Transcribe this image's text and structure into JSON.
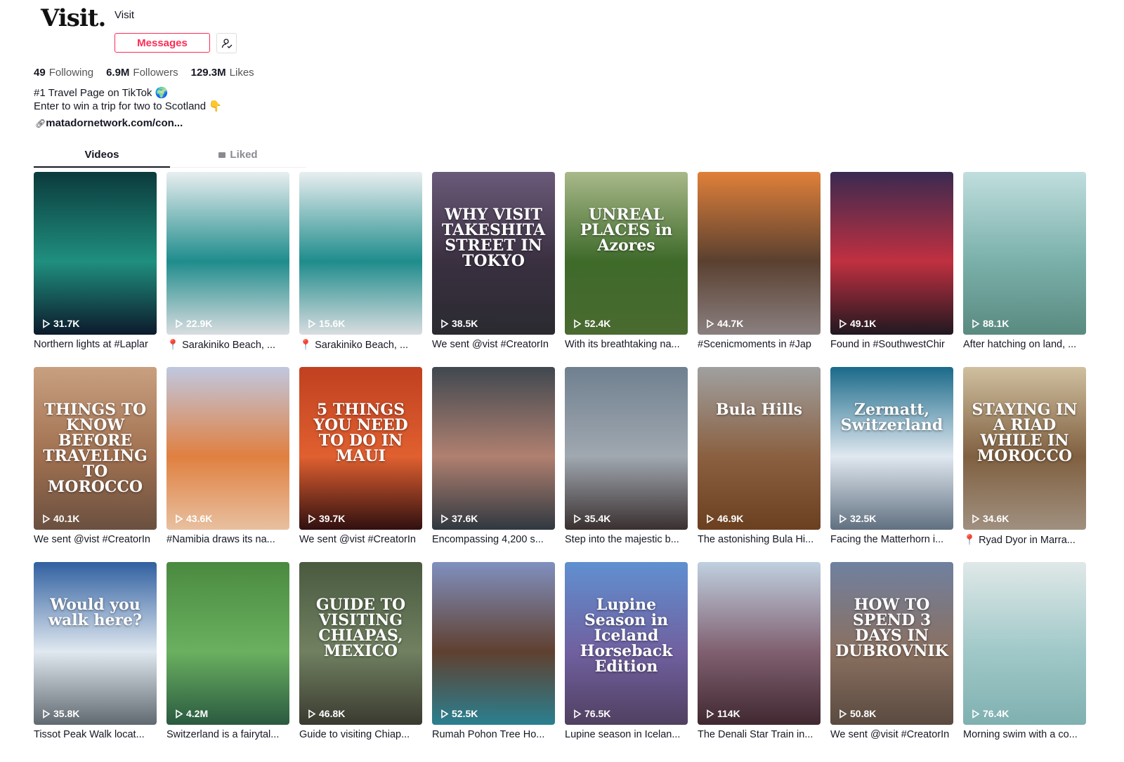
{
  "profile": {
    "logo_text": "Visit.",
    "username": "Visit",
    "messages_label": "Messages",
    "stats": [
      {
        "value": "49",
        "label": "Following"
      },
      {
        "value": "6.9M",
        "label": "Followers"
      },
      {
        "value": "129.3M",
        "label": "Likes"
      }
    ],
    "bio_line1": "#1 Travel Page on TikTok 🌍",
    "bio_line2": "Enter to win a trip for two to Scotland 👇",
    "link": "matadornetwork.com/con..."
  },
  "tabs": {
    "videos": "Videos",
    "liked": "Liked"
  },
  "accent": "#fe2c55",
  "videos": [
    {
      "views": "31.7K",
      "caption": "Northern lights at #Laplar",
      "overlay": "",
      "colors": [
        "#0b3a3c",
        "#1f8f7f",
        "#0c1a2c"
      ]
    },
    {
      "views": "22.9K",
      "caption": "📍 Sarakiniko Beach, ...",
      "overlay": "",
      "colors": [
        "#e9eef0",
        "#1f8c8c",
        "#d9dde0"
      ]
    },
    {
      "views": "15.6K",
      "caption": "📍 Sarakiniko Beach, ...",
      "overlay": "",
      "colors": [
        "#e9eef0",
        "#1f8c8c",
        "#d9dde0"
      ]
    },
    {
      "views": "38.5K",
      "caption": "We sent @vist #CreatorIn",
      "overlay": "WHY VISIT TAKESHITA STREET IN TOKYO",
      "colors": [
        "#6a5a7a",
        "#3a3040",
        "#2a2a30"
      ]
    },
    {
      "views": "52.4K",
      "caption": "With its breathtaking na...",
      "overlay": "UNREAL PLACES in Azores",
      "colors": [
        "#a9b98a",
        "#3e6a2a",
        "#4a6a30"
      ]
    },
    {
      "views": "44.7K",
      "caption": "#Scenicmoments in #Jap",
      "overlay": "",
      "colors": [
        "#e0803a",
        "#5a4030",
        "#8a8080"
      ]
    },
    {
      "views": "49.1K",
      "caption": "Found in #SouthwestChir",
      "overlay": "",
      "colors": [
        "#3a2a50",
        "#c03040",
        "#201820"
      ]
    },
    {
      "views": "88.1K",
      "caption": "After hatching on land, ...",
      "overlay": "",
      "colors": [
        "#c0dede",
        "#7ab0aa",
        "#5a8a80"
      ]
    },
    {
      "views": "40.1K",
      "caption": "We sent @vist #CreatorIn",
      "overlay": "THINGS TO KNOW BEFORE TRAVELING TO MOROCCO",
      "colors": [
        "#c8a080",
        "#a07050",
        "#6a5040"
      ]
    },
    {
      "views": "43.6K",
      "caption": "#Namibia draws its na...",
      "overlay": "",
      "colors": [
        "#c0c8e0",
        "#e08040",
        "#e8c0a0"
      ]
    },
    {
      "views": "39.7K",
      "caption": "We sent @vist #CreatorIn",
      "overlay": "5 THINGS YOU NEED TO DO IN MAUI",
      "colors": [
        "#c04020",
        "#e06030",
        "#301010"
      ]
    },
    {
      "views": "37.6K",
      "caption": "Encompassing 4,200 s...",
      "overlay": "",
      "colors": [
        "#404850",
        "#b08070",
        "#303840"
      ]
    },
    {
      "views": "35.4K",
      "caption": "Step into the majestic b...",
      "overlay": "",
      "colors": [
        "#708090",
        "#a0a8b0",
        "#3a3030"
      ]
    },
    {
      "views": "46.9K",
      "caption": "The astonishing Bula Hi...",
      "overlay": "Bula Hills",
      "colors": [
        "#a0a0a0",
        "#8a6040",
        "#6a4020"
      ]
    },
    {
      "views": "32.5K",
      "caption": "Facing the Matterhorn i...",
      "overlay": "Zermatt, Switzerland",
      "colors": [
        "#1a6a8a",
        "#e0e8f0",
        "#607080"
      ]
    },
    {
      "views": "34.6K",
      "caption": "📍 Ryad Dyor in Marra...",
      "overlay": "STAYING IN A RIAD WHILE IN MOROCCO",
      "colors": [
        "#d0c0a0",
        "#806040",
        "#a09080"
      ]
    },
    {
      "views": "35.8K",
      "caption": "Tissot Peak Walk locat...",
      "overlay": "Would you walk here?",
      "colors": [
        "#3060a0",
        "#e0e8f0",
        "#606870"
      ]
    },
    {
      "views": "4.2M",
      "caption": "Switzerland is a fairytal...",
      "overlay": "",
      "colors": [
        "#4a8a40",
        "#6ab060",
        "#2a5a40"
      ]
    },
    {
      "views": "46.8K",
      "caption": "Guide to visiting Chiap...",
      "overlay": "GUIDE TO VISITING CHIAPAS, MEXICO",
      "colors": [
        "#4a5a40",
        "#708060",
        "#3a3a30"
      ]
    },
    {
      "views": "52.5K",
      "caption": "Rumah Pohon Tree Ho...",
      "overlay": "",
      "colors": [
        "#8090c0",
        "#604030",
        "#2a8090"
      ]
    },
    {
      "views": "76.5K",
      "caption": "Lupine season in Icelan...",
      "overlay": "Lupine Season in Iceland Horseback Edition",
      "colors": [
        "#6090d0",
        "#7060a0",
        "#504060"
      ]
    },
    {
      "views": "114K",
      "caption": "The Denali Star Train in...",
      "overlay": "",
      "colors": [
        "#c0d0e0",
        "#806070",
        "#402830"
      ]
    },
    {
      "views": "50.8K",
      "caption": "We sent @visit #CreatorIn",
      "overlay": "HOW TO SPEND 3 DAYS IN DUBROVNIK",
      "colors": [
        "#7080a0",
        "#8a7060",
        "#5a4a40"
      ]
    },
    {
      "views": "76.4K",
      "caption": "Morning swim with a co...",
      "overlay": "",
      "colors": [
        "#e0e8e8",
        "#a0c8c8",
        "#80b0b0"
      ]
    }
  ]
}
